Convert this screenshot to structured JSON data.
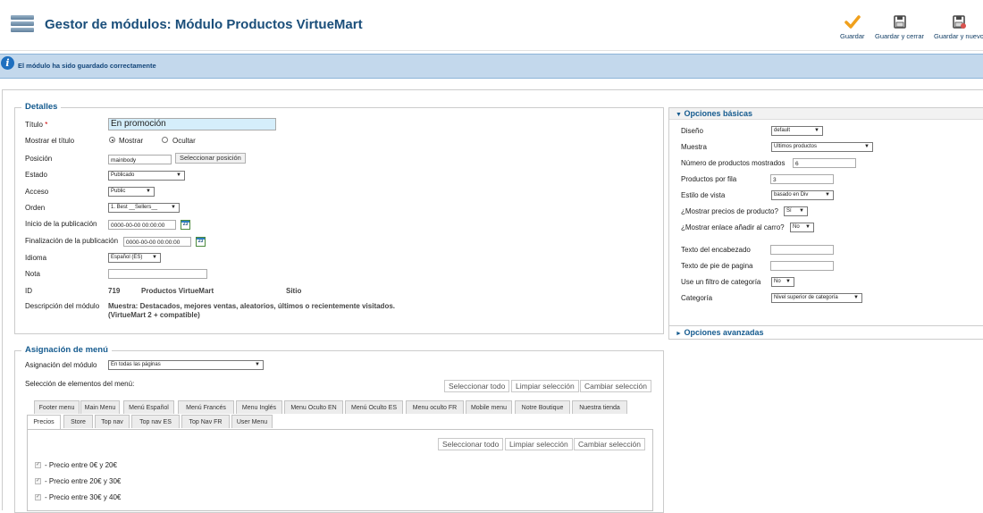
{
  "header": {
    "title": "Gestor de módulos: Módulo Productos VirtueMart",
    "toolbar": {
      "save": "Guardar",
      "save_close": "Guardar y cerrar",
      "save_new": "Guardar y nuevo"
    }
  },
  "message": "El módulo ha sido guardado correctamente",
  "details": {
    "legend": "Detalles",
    "title_label": "Título",
    "required_mark": "*",
    "title_value": "En promoción",
    "show_title_label": "Mostrar el título",
    "show": "Mostrar",
    "hide": "Ocultar",
    "position_label": "Posición",
    "position_value": "mainbody",
    "select_position": "Seleccionar posición",
    "state_label": "Estado",
    "state_value": "Publicado",
    "access_label": "Acceso",
    "access_value": "Public",
    "order_label": "Orden",
    "order_value": "1. Best __Sellers__",
    "publish_start_label": "Inicio de la publicación",
    "publish_start_value": "0000-00-00 00:00:00",
    "publish_end_label": "Finalización de la publicación",
    "publish_end_value": "0000-00-00 00:00:00",
    "calendar_day": "23",
    "language_label": "Idioma",
    "language_value": "Español (ES)",
    "note_label": "Nota",
    "note_value": "",
    "id_label": "ID",
    "id_value": "719",
    "module_name": "Productos VirtueMart",
    "site": "Sitio",
    "desc_label": "Descripción del módulo",
    "desc_line1": "Muestra: Destacados, mejores ventas, aleatorios, últimos o recientemente visitados.",
    "desc_line2": "(VirtueMart 2 + compatible)"
  },
  "menu_assignment": {
    "legend": "Asignación de menú",
    "module_assignment_label": "Asignación del módulo",
    "module_assignment_value": "En todas las páginas",
    "items_label": "Selección de elementos del menú:",
    "select_all": "Seleccionar todo",
    "clear_selection": "Limpiar selección",
    "toggle_selection": "Cambiar selección",
    "tabs_row1": [
      "Footer menu",
      "Main Menu",
      "Menú Español",
      "Menú Francés",
      "Menu Inglés",
      "Menu Oculto EN",
      "Menú Oculto ES",
      "Menu oculto FR",
      "Mobile menu",
      "Notre Boutique",
      "Nuestra tienda"
    ],
    "tabs_row2": [
      "Precios",
      "Store",
      "Top nav",
      "Top nav ES",
      "Top Nav FR",
      "User Menu"
    ],
    "items": [
      "- Precio entre 0€ y 20€",
      "- Precio entre 20€ y 30€",
      "- Precio entre 30€ y 40€"
    ]
  },
  "basic_options": {
    "title": "Opciones básicas",
    "layout_label": "Diseño",
    "layout_value": "default",
    "show_label": "Muestra",
    "show_value": "Últimos productos",
    "num_products_label": "Número de productos mostrados",
    "num_products_value": "6",
    "per_row_label": "Productos por fila",
    "per_row_value": "3",
    "view_style_label": "Estilo de vista",
    "view_style_value": "basado en Div",
    "show_prices_label": "¿Mostrar precios de producto?",
    "show_prices_value": "Sí",
    "show_addcart_label": "¿Mostrar enlace añadir al carro?",
    "show_addcart_value": "No",
    "header_text_label": "Texto del encabezado",
    "footer_text_label": "Texto de pie de pagina",
    "cat_filter_label": "Use un filtro de categoría",
    "cat_filter_value": "No",
    "category_label": "Categoría",
    "category_value": "Nivel superior de categoría"
  },
  "advanced_options": {
    "title": "Opciones avanzadas"
  }
}
